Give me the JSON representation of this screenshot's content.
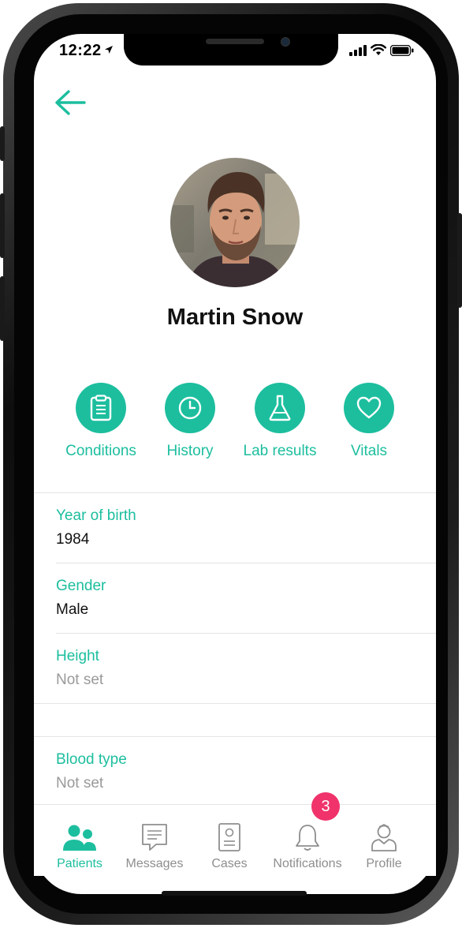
{
  "status_bar": {
    "time": "12:22"
  },
  "patient": {
    "name": "Martin Snow"
  },
  "actions": [
    {
      "label": "Conditions",
      "icon": "clipboard-icon"
    },
    {
      "label": "History",
      "icon": "clock-icon"
    },
    {
      "label": "Lab results",
      "icon": "flask-icon"
    },
    {
      "label": "Vitals",
      "icon": "heart-icon"
    }
  ],
  "fields": [
    {
      "label": "Year of birth",
      "value": "1984"
    },
    {
      "label": "Gender",
      "value": "Male"
    },
    {
      "label": "Height",
      "value": "Not set"
    },
    {
      "label": "Blood type",
      "value": "Not set"
    }
  ],
  "tab_bar": {
    "tabs": [
      {
        "label": "Patients",
        "icon": "patients-icon",
        "active": true
      },
      {
        "label": "Messages",
        "icon": "message-icon"
      },
      {
        "label": "Cases",
        "icon": "cases-icon"
      },
      {
        "label": "Notifications",
        "icon": "bell-icon"
      },
      {
        "label": "Profile",
        "icon": "profile-icon"
      }
    ],
    "notification_badge": "3"
  },
  "colors": {
    "accent": "#1cbe9e",
    "badge": "#f0336b",
    "muted_text": "#9a9a9a"
  }
}
